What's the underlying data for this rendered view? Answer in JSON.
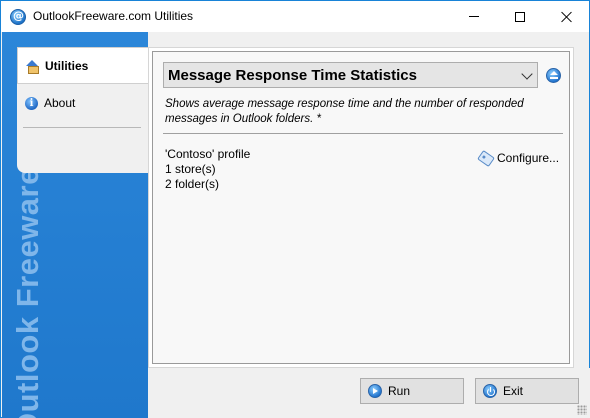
{
  "window": {
    "title": "OutlookFreeware.com Utilities",
    "accent_color": "#1883d7"
  },
  "sidebar": {
    "watermark": "Outlook Freeware.com",
    "background_color": "#2281d4",
    "tabs": [
      {
        "label": "Utilities",
        "icon": "home-icon",
        "selected": true
      },
      {
        "label": "About",
        "icon": "info-icon",
        "selected": false
      }
    ]
  },
  "main": {
    "utility_select": {
      "selected": "Message Response Time Statistics",
      "icon": "chevron-down-icon"
    },
    "eject_icon": "eject-icon",
    "description": "Shows average message response time and the number of responded messages in Outlook folders. *",
    "profile_lines": [
      "'Contoso' profile",
      "1 store(s)",
      "2 folder(s)"
    ],
    "configure": {
      "label": "Configure...",
      "icon": "tag-icon"
    }
  },
  "footer": {
    "run": {
      "label": "Run",
      "icon": "play-icon"
    },
    "exit": {
      "label": "Exit",
      "icon": "power-icon"
    }
  }
}
